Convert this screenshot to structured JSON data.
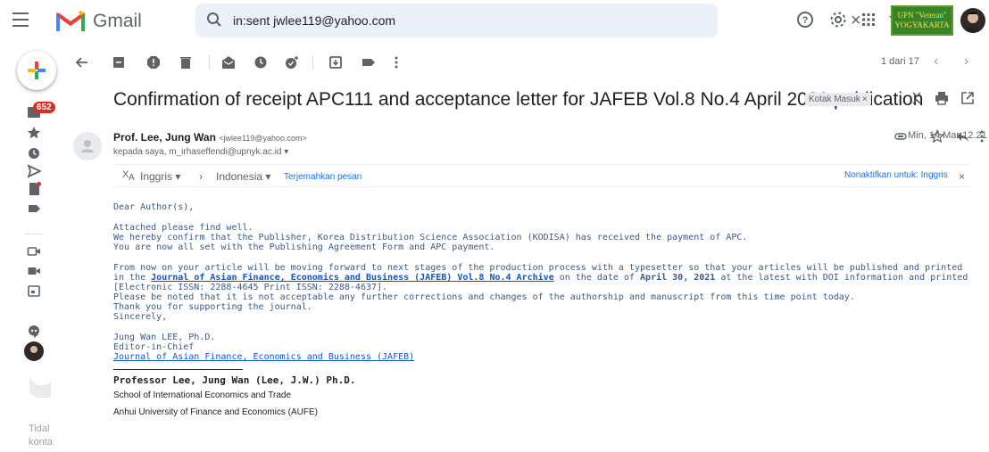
{
  "app": {
    "brand": "Gmail"
  },
  "search": {
    "query": "in:sent jwlee119@yahoo.com"
  },
  "org": {
    "line1": "UPN \"Veteran\"",
    "line2": "YOGYAKARTA"
  },
  "rail": {
    "inbox_count": "652",
    "trailing_text_1": "Tidal",
    "trailing_text_2": "konta"
  },
  "pager": {
    "text": "1 dari 17"
  },
  "email": {
    "subject": "Confirmation of receipt APC111 and acceptance letter for JAFEB Vol.8 No.4 April 2021 publication",
    "label": "Kotak Masuk",
    "label_close": "×",
    "sender_name": "Prof. Lee, Jung Wan",
    "sender_email": "<jwlee119@yahoo.com>",
    "recipients": "kepada saya, m_irhaseffendi@upnyk.ac.id",
    "date": "Min, 14 Mar 12.21"
  },
  "translate": {
    "from_lang": "Inggris",
    "to_lang": "Indonesia",
    "translate_link": "Terjemahkan pesan",
    "disable_link": "Nonaktifkan untuk: Inggris"
  },
  "body": {
    "greeting": "Dear Author(s),",
    "p1": "Attached please find well.",
    "p2": "We hereby confirm that the Publisher, Korea Distribution Science Association (KODISA) has received the payment of APC.",
    "p3": "You are now all set with the Publishing Agreement Form and APC payment.",
    "p4_start": "From now on your article will be moving forward to next stages of the production process with a typesetter so that your articles will be published and printed in the ",
    "p4_link": "Journal of Asian Finance, Economics and Business (JAFEB) Vol.8 No.4 Archive",
    "p4_mid": " on the date of ",
    "p4_date": "April 30, 2021",
    "p4_end": " at the latest with DOI information and printed [Electronic ISSN: 2288-4645 Print ISSN: 2288-4637].",
    "p5": "Please be noted that it is not acceptable any further corrections and changes of the authorship and manuscript from this time point today.",
    "p6": "Thank you for supporting the journal.",
    "p7": "Sincerely,",
    "sig1": "Jung Wan LEE, Ph.D.",
    "sig2": "Editor-in-Chief",
    "sig3": "Journal of Asian Finance, Economics and Business (JAFEB)",
    "sig4": "Professor Lee, Jung Wan (Lee, J.W.) Ph.D.",
    "sig5": "School of International Economics and Trade",
    "sig6": "Anhui University of Finance and Economics (AUFE)"
  }
}
